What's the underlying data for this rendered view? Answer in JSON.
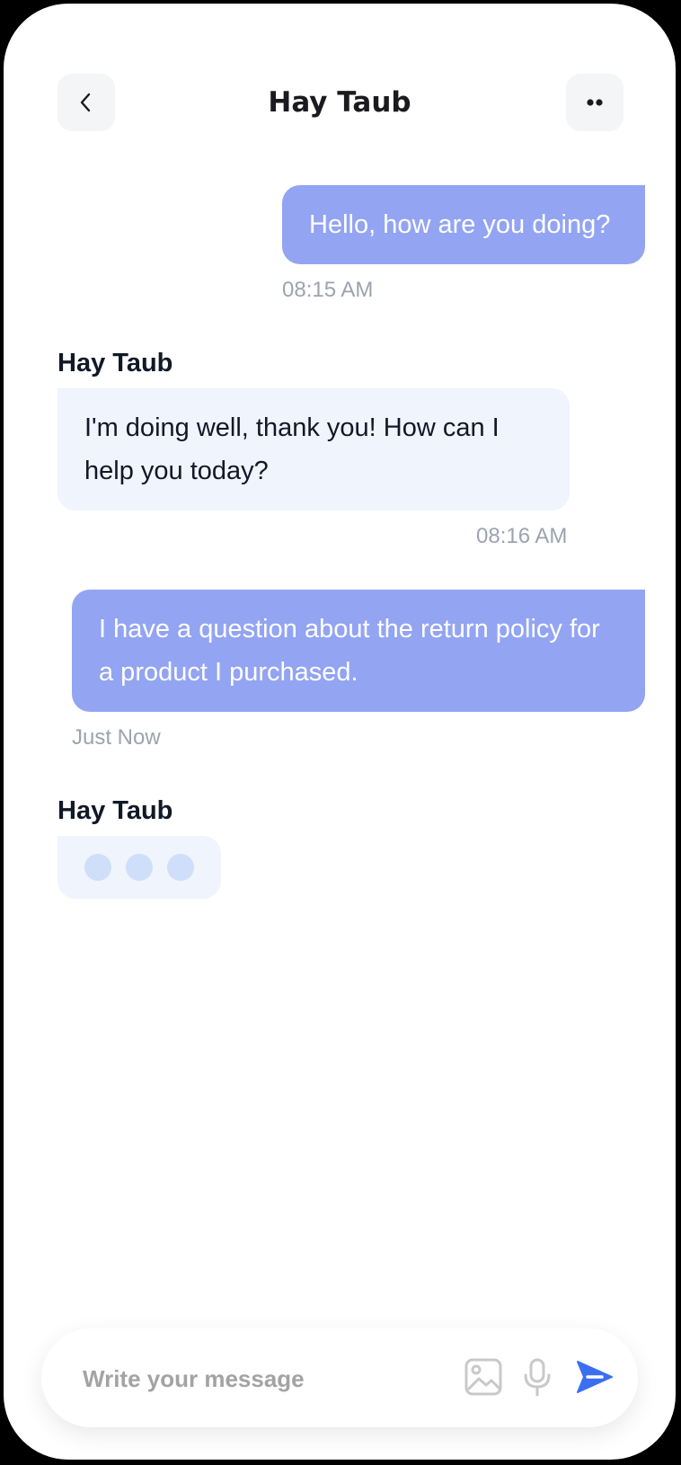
{
  "header": {
    "title": "Hay Taub",
    "back_icon": "chevron-left-icon",
    "more_icon": "more-dots-icon"
  },
  "messages": [
    {
      "direction": "outgoing",
      "text": "Hello, how are you doing?",
      "time": "08:15 AM"
    },
    {
      "direction": "incoming",
      "sender": "Hay Taub",
      "text": "I'm doing well, thank you! How can I help you today?",
      "time": "08:16 AM"
    },
    {
      "direction": "outgoing",
      "text": "I have a question about the return policy for a product I purchased.",
      "time": "Just Now"
    }
  ],
  "typing": {
    "sender": "Hay Taub"
  },
  "composer": {
    "placeholder": "Write your message",
    "value": "",
    "icons": [
      "image-icon",
      "microphone-icon",
      "send-icon"
    ]
  },
  "colors": {
    "outgoing_bubble": "#93A4F3",
    "incoming_bubble": "#EFF4FD",
    "typing_dot": "#CFDEF9",
    "send_accent": "#3B6FF0",
    "header_button_bg": "#F3F5F6"
  }
}
